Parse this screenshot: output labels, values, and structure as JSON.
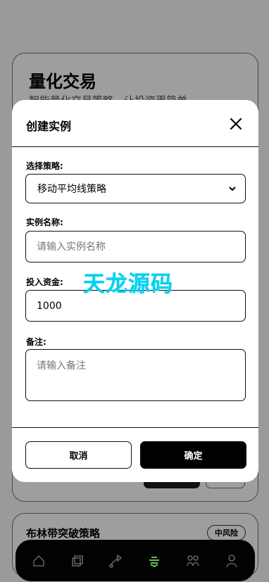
{
  "background": {
    "title": "量化交易",
    "subtitle": "智能量化交易策略，让投资更简单",
    "second_card": {
      "title": "布林带突破策略",
      "risk": "中风险"
    }
  },
  "modal": {
    "title": "创建实例",
    "strategy_label": "选择策略:",
    "strategy_value": "移动平均线策略",
    "name_label": "实例名称:",
    "name_placeholder": "请输入实例名称",
    "capital_label": "投入资金:",
    "capital_value": "1000",
    "notes_label": "备注:",
    "notes_placeholder": "请输入备注",
    "cancel_label": "取消",
    "confirm_label": "确定"
  },
  "watermark": "天龙源码",
  "bottom_nav": {
    "items": [
      "home-icon",
      "copy-icon",
      "route-icon",
      "strategy-icon",
      "community-icon",
      "profile-icon"
    ],
    "active_index": 3,
    "active_color": "#7fd35b"
  },
  "colors": {
    "overlay": "#9a9a9a",
    "watermark": "#00d3f0"
  }
}
